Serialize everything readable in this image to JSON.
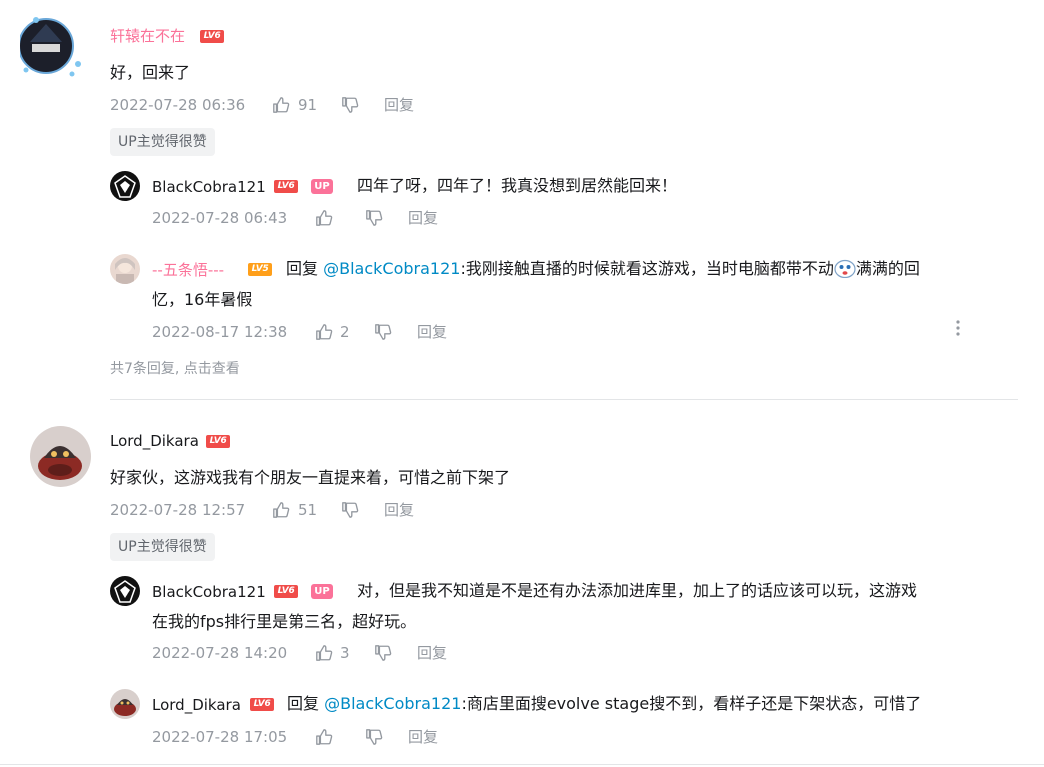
{
  "colors": {
    "username_pink": "#fb7299",
    "text": "#18191c",
    "meta": "#9499a0",
    "mention": "#008ac5",
    "lv6": "#f04c49",
    "lv5": "#ff9f1a",
    "up_badge": "#fb7299"
  },
  "comment1": {
    "username": "轩辕在不在",
    "level": "LV6",
    "text": "好，回来了",
    "time": "2022-07-28 06:36",
    "likes": "91",
    "reply_label": "回复",
    "tag": "UP主觉得很赞",
    "replies": [
      {
        "username": "BlackCobra121",
        "level": "LV6",
        "badge": "UP",
        "text": "四年了呀，四年了！我真没想到居然能回来！",
        "time": "2022-07-28 06:43",
        "likes": "",
        "reply_label": "回复"
      },
      {
        "username": "--五条悟---",
        "level": "LV5",
        "prefix": "回复",
        "mention": "@BlackCobra121",
        "text_line1": ":我刚接触直播的时候就看这游戏，当时电脑都带不动",
        "text_line1_tail": "满满的回",
        "text_line2": "忆，16年暑假",
        "time": "2022-08-17 12:38",
        "likes": "2",
        "reply_label": "回复"
      }
    ],
    "more_replies": "共7条回复, 点击查看"
  },
  "comment2": {
    "username": "Lord_Dikara",
    "level": "LV6",
    "text": "好家伙，这游戏我有个朋友一直提来着，可惜之前下架了",
    "time": "2022-07-28 12:57",
    "likes": "51",
    "reply_label": "回复",
    "tag": "UP主觉得很赞",
    "replies": [
      {
        "username": "BlackCobra121",
        "level": "LV6",
        "badge": "UP",
        "text_line1": "对，但是我不知道是不是还有办法添加进库里，加上了的话应该可以玩，这游戏",
        "text_line2": "在我的fps排行里是第三名，超好玩。",
        "time": "2022-07-28 14:20",
        "likes": "3",
        "reply_label": "回复"
      },
      {
        "username": "Lord_Dikara",
        "level": "LV6",
        "prefix": "回复",
        "mention": "@BlackCobra121",
        "text": ":商店里面搜evolve stage搜不到，看样子还是下架状态，可惜了",
        "time": "2022-07-28 17:05",
        "likes": "",
        "reply_label": "回复"
      }
    ]
  }
}
